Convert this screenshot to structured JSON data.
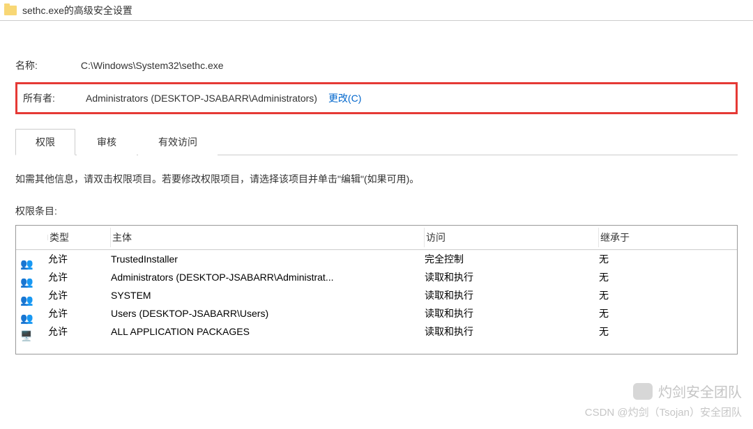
{
  "window": {
    "title": "sethc.exe的高级安全设置"
  },
  "name_row": {
    "label": "名称:",
    "value": "C:\\Windows\\System32\\sethc.exe"
  },
  "owner_row": {
    "label": "所有者:",
    "value": "Administrators (DESKTOP-JSABARR\\Administrators)",
    "change_link": "更改(C)"
  },
  "tabs": {
    "items": [
      {
        "label": "权限"
      },
      {
        "label": "审核"
      },
      {
        "label": "有效访问"
      }
    ],
    "active_index": 0
  },
  "instruction": "如需其他信息，请双击权限项目。若要修改权限项目，请选择该项目并单击\"编辑\"(如果可用)。",
  "entries_label": "权限条目:",
  "table": {
    "headers": {
      "icon": "",
      "type": "类型",
      "principal": "主体",
      "access": "访问",
      "inherited": "继承于"
    },
    "rows": [
      {
        "icon": "group",
        "type": "允许",
        "principal": "TrustedInstaller",
        "access": "完全控制",
        "inherited": "无"
      },
      {
        "icon": "group",
        "type": "允许",
        "principal": "Administrators (DESKTOP-JSABARR\\Administrat...",
        "access": "读取和执行",
        "inherited": "无"
      },
      {
        "icon": "group",
        "type": "允许",
        "principal": "SYSTEM",
        "access": "读取和执行",
        "inherited": "无"
      },
      {
        "icon": "group",
        "type": "允许",
        "principal": "Users (DESKTOP-JSABARR\\Users)",
        "access": "读取和执行",
        "inherited": "无"
      },
      {
        "icon": "pkg",
        "type": "允许",
        "principal": "ALL APPLICATION PACKAGES",
        "access": "读取和执行",
        "inherited": "无"
      }
    ]
  },
  "watermark": {
    "line1": "灼剑安全团队",
    "line2": "CSDN @灼剑（Tsojan）安全团队"
  }
}
